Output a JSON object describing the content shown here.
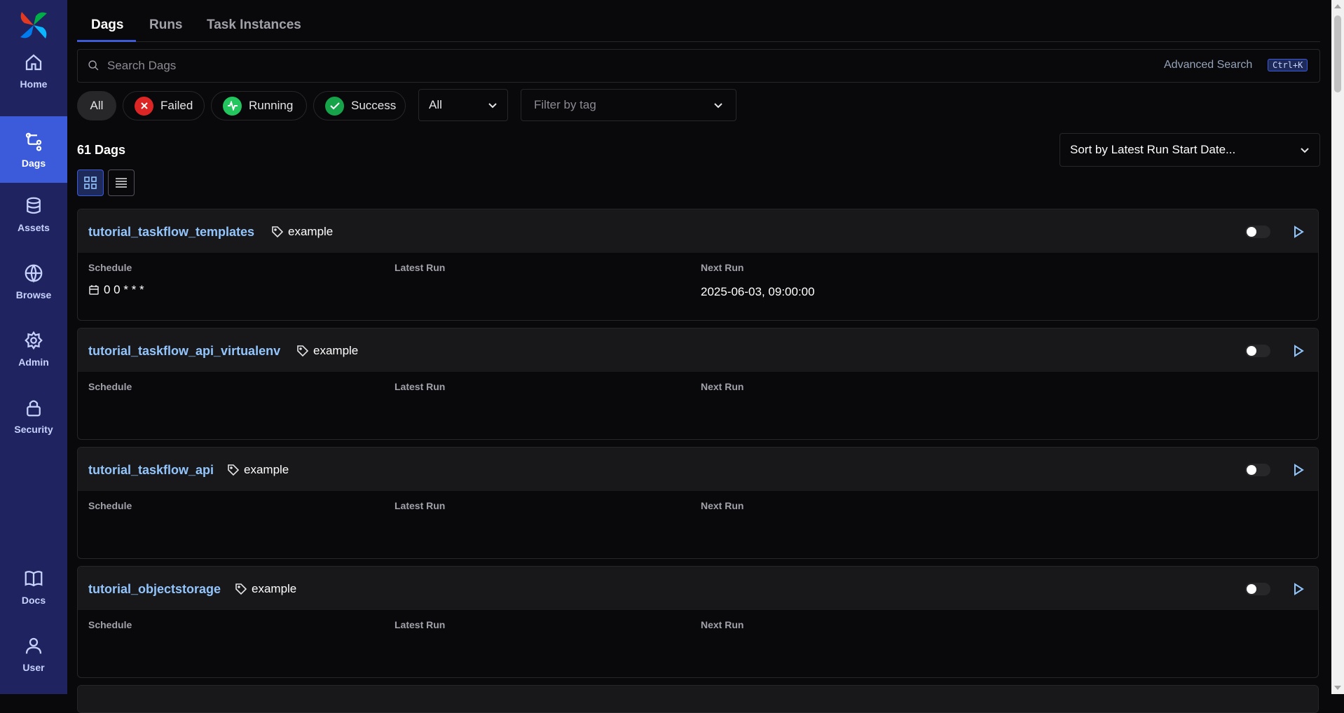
{
  "sidebar": {
    "items": [
      {
        "label": "Home",
        "icon": "home-icon"
      },
      {
        "label": "Dags",
        "icon": "dags-icon",
        "active": true
      },
      {
        "label": "Assets",
        "icon": "database-icon"
      },
      {
        "label": "Browse",
        "icon": "globe-icon"
      },
      {
        "label": "Admin",
        "icon": "gear-icon"
      },
      {
        "label": "Security",
        "icon": "lock-icon"
      },
      {
        "label": "Docs",
        "icon": "book-icon"
      },
      {
        "label": "User",
        "icon": "user-icon"
      }
    ]
  },
  "tabs": [
    "Dags",
    "Runs",
    "Task Instances"
  ],
  "search": {
    "placeholder": "Search Dags",
    "advanced": "Advanced Search",
    "shortcut": "Ctrl+K"
  },
  "filters": {
    "all": "All",
    "failed": "Failed",
    "running": "Running",
    "success": "Success",
    "paused_select": "All",
    "tag_placeholder": "Filter by tag"
  },
  "count_label": "61 Dags",
  "sort_label": "Sort by Latest Run Start Date...",
  "columns": {
    "schedule": "Schedule",
    "latest_run": "Latest Run",
    "next_run": "Next Run"
  },
  "dags": [
    {
      "name": "tutorial_taskflow_templates",
      "tag": "example",
      "schedule": "0 0 * * *",
      "next_run": "2025-06-03, 09:00:00"
    },
    {
      "name": "tutorial_taskflow_api_virtualenv",
      "tag": "example",
      "schedule": "",
      "next_run": ""
    },
    {
      "name": "tutorial_taskflow_api",
      "tag": "example",
      "schedule": "",
      "next_run": ""
    },
    {
      "name": "tutorial_objectstorage",
      "tag": "example",
      "schedule": "",
      "next_run": ""
    }
  ],
  "colors": {
    "accent": "#3b5bdb",
    "failed": "#dc2626",
    "running": "#22c55e",
    "success": "#16a34a",
    "link": "#93c5fd"
  }
}
